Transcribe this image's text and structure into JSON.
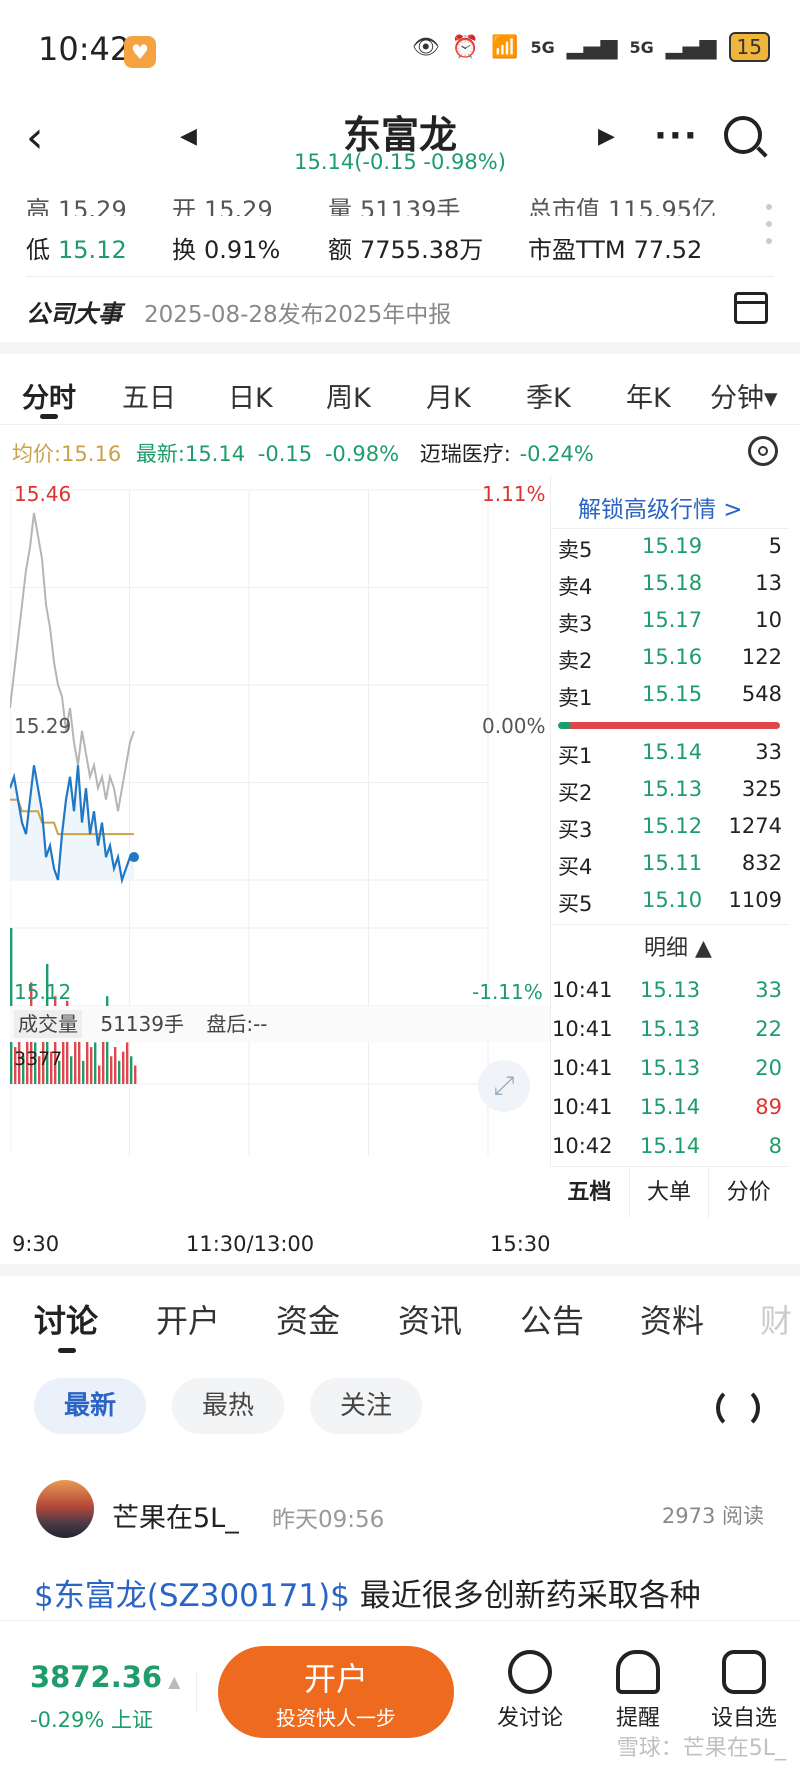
{
  "status_bar": {
    "time": "10:42",
    "network1": "5G",
    "network2": "5G",
    "battery": "15"
  },
  "header": {
    "title": "东富龙",
    "subtitle": "15.14(-0.15 -0.98%)"
  },
  "quote": {
    "high_label": "高",
    "high": "15.29",
    "open_label": "开",
    "open": "15.29",
    "volume_label": "量",
    "volume": "51139手",
    "mcap_label": "总市值",
    "mcap": "115.95亿",
    "low_label": "低",
    "low": "15.12",
    "turnover_label": "换",
    "turnover": "0.91%",
    "amount_label": "额",
    "amount": "7755.38万",
    "pe_label": "市盈TTM",
    "pe": "77.52"
  },
  "event": {
    "label": "公司大事",
    "text": "2025-08-28发布2025年中报"
  },
  "chart_tabs": [
    "分时",
    "五日",
    "日K",
    "周K",
    "月K",
    "季K",
    "年K",
    "分钟▾"
  ],
  "info": {
    "avg": "均价:15.16",
    "latest": "最新:15.14",
    "change": "-0.15",
    "pct": "-0.98%",
    "peer": "迈瑞医疗:",
    "peer_pct": "-0.24%"
  },
  "chart_labels": {
    "top_price": "15.46",
    "top_pct": "1.11%",
    "mid_price": "15.29",
    "mid_pct": "0.00%",
    "bot_price": "15.12",
    "bot_pct": "-1.11%",
    "vol_label": "成交量",
    "vol_value": "51139手",
    "after_hours": "盘后:--",
    "vol_max": "3377",
    "x_start": "9:30",
    "x_mid": "11:30/13:00",
    "x_end": "15:30"
  },
  "chart_data": {
    "type": "line",
    "y_range": [
      15.12,
      15.46
    ],
    "prev_close": 15.29,
    "series": [
      {
        "values": [
          15.2,
          15.21,
          15.19,
          15.17,
          15.16,
          15.19,
          15.22,
          15.2,
          15.18,
          15.14,
          15.15,
          15.13,
          15.12,
          15.16,
          15.19,
          15.21,
          15.18,
          15.22,
          15.17,
          15.2,
          15.16,
          15.18,
          15.15,
          15.17,
          15.14,
          15.15,
          15.13,
          15.14,
          15.12,
          15.13,
          15.14,
          15.14
        ]
      },
      {
        "values": [
          15.19,
          15.19,
          15.19,
          15.18,
          15.18,
          15.18,
          15.18,
          15.18,
          15.17,
          15.17,
          15.17,
          15.17,
          15.16,
          15.16,
          15.16,
          15.16,
          15.16,
          15.16,
          15.16,
          15.16,
          15.16,
          15.16,
          15.16,
          15.16,
          15.16,
          15.16,
          15.16,
          15.16,
          15.16,
          15.16,
          15.16,
          15.16
        ]
      },
      {
        "name": "迈瑞医疗",
        "values": [
          15.27,
          15.3,
          15.33,
          15.36,
          15.39,
          15.41,
          15.44,
          15.42,
          15.4,
          15.36,
          15.34,
          15.31,
          15.29,
          15.28,
          15.25,
          15.27,
          15.24,
          15.22,
          15.25,
          15.23,
          15.21,
          15.22,
          15.2,
          15.21,
          15.19,
          15.21,
          15.2,
          15.18,
          15.2,
          15.22,
          15.24,
          15.25
        ]
      }
    ],
    "volume": [
      3377,
      800,
      1500,
      600,
      1200,
      2200,
      900,
      600,
      1100,
      2600,
      700,
      1900,
      500,
      1400,
      1800,
      600,
      1000,
      1300,
      500,
      1600,
      800,
      900,
      400,
      1100,
      1900,
      600,
      800,
      500,
      700,
      900,
      600,
      400
    ]
  },
  "orderbook": {
    "unlock": "解锁高级行情 >",
    "sells": [
      {
        "label": "卖5",
        "price": "15.19",
        "qty": "5"
      },
      {
        "label": "卖4",
        "price": "15.18",
        "qty": "13"
      },
      {
        "label": "卖3",
        "price": "15.17",
        "qty": "10"
      },
      {
        "label": "卖2",
        "price": "15.16",
        "qty": "122"
      },
      {
        "label": "卖1",
        "price": "15.15",
        "qty": "548"
      }
    ],
    "buys": [
      {
        "label": "买1",
        "price": "15.14",
        "qty": "33"
      },
      {
        "label": "买2",
        "price": "15.13",
        "qty": "325"
      },
      {
        "label": "买3",
        "price": "15.12",
        "qty": "1274"
      },
      {
        "label": "买4",
        "price": "15.11",
        "qty": "832"
      },
      {
        "label": "买5",
        "price": "15.10",
        "qty": "1109"
      }
    ],
    "detail_label": "明细 ▲",
    "ticks": [
      {
        "time": "10:41",
        "price": "15.13",
        "qty": "33"
      },
      {
        "time": "10:41",
        "price": "15.13",
        "qty": "22"
      },
      {
        "time": "10:41",
        "price": "15.13",
        "qty": "20"
      },
      {
        "time": "10:41",
        "price": "15.14",
        "qty": "89"
      },
      {
        "time": "10:42",
        "price": "15.14",
        "qty": "8"
      }
    ],
    "tabs": [
      "五档",
      "大单",
      "分价"
    ]
  },
  "discussion_tabs": [
    "讨论",
    "开户",
    "资金",
    "资讯",
    "公告",
    "资料",
    "财"
  ],
  "filters": [
    "最新",
    "最热",
    "关注"
  ],
  "post": {
    "user": "芒果在5L_",
    "time": "昨天09:56",
    "reads": "2973 阅读",
    "stock": "$东富龙(SZ300171)$",
    "text": " 最近很多创新药采取各种"
  },
  "bottom": {
    "index_value": "3872.36",
    "index_arrow": "▲",
    "index_sub": "-0.29% 上证",
    "open_title": "开户",
    "open_sub": "投资快人一步",
    "discuss": "发讨论",
    "alert": "提醒",
    "watch": "设自选",
    "watermark": "雪球：芒果在5L_"
  },
  "colors": {
    "green": "#1e9c6b",
    "red": "#d33333",
    "blue": "#2a64c4",
    "orange": "#ee6a1f",
    "avg_line": "#c9a24a",
    "peer_line": "#b5b5b5"
  }
}
